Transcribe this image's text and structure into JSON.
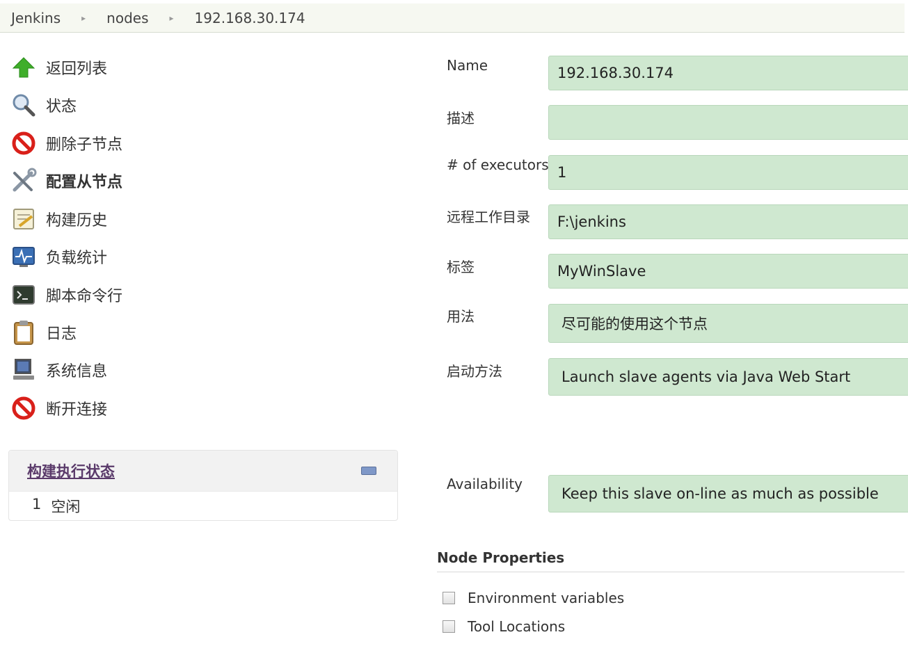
{
  "breadcrumb": {
    "items": [
      "Jenkins",
      "nodes",
      "192.168.30.174"
    ],
    "separator": "▸"
  },
  "sidebar": {
    "items": [
      {
        "label": "返回列表",
        "icon": "up-arrow-icon"
      },
      {
        "label": "状态",
        "icon": "magnifier-icon"
      },
      {
        "label": "删除子节点",
        "icon": "no-entry-icon"
      },
      {
        "label": "配置从节点",
        "icon": "tools-icon",
        "active": true
      },
      {
        "label": "构建历史",
        "icon": "notepad-icon"
      },
      {
        "label": "负载统计",
        "icon": "monitor-graph-icon"
      },
      {
        "label": "脚本命令行",
        "icon": "terminal-icon"
      },
      {
        "label": "日志",
        "icon": "clipboard-icon"
      },
      {
        "label": "系统信息",
        "icon": "computer-icon"
      },
      {
        "label": "断开连接",
        "icon": "no-entry-icon"
      }
    ]
  },
  "executor_status": {
    "title": "构建执行状态",
    "rows": [
      {
        "number": "1",
        "state": "空闲"
      }
    ]
  },
  "form": {
    "name": {
      "label": "Name",
      "value": "192.168.30.174"
    },
    "description": {
      "label": "描述",
      "value": ""
    },
    "executors": {
      "label": "# of executors",
      "value": "1"
    },
    "remote_dir": {
      "label": "远程工作目录",
      "value": "F:\\jenkins"
    },
    "labels": {
      "label": "标签",
      "value": "MyWinSlave"
    },
    "usage": {
      "label": "用法",
      "value": "尽可能的使用这个节点"
    },
    "launch_method": {
      "label": "启动方法",
      "value": "Launch slave agents via Java Web Start"
    },
    "availability": {
      "label": "Availability",
      "value": "Keep this slave on-line as much as possible"
    }
  },
  "node_properties": {
    "title": "Node Properties",
    "options": [
      {
        "label": "Environment variables",
        "checked": false
      },
      {
        "label": "Tool Locations",
        "checked": false
      }
    ]
  },
  "colors": {
    "input_bg": "#cfe8d0",
    "breadcrumb_bg": "#f6f8f1",
    "exec_title": "#5a3a6a"
  }
}
